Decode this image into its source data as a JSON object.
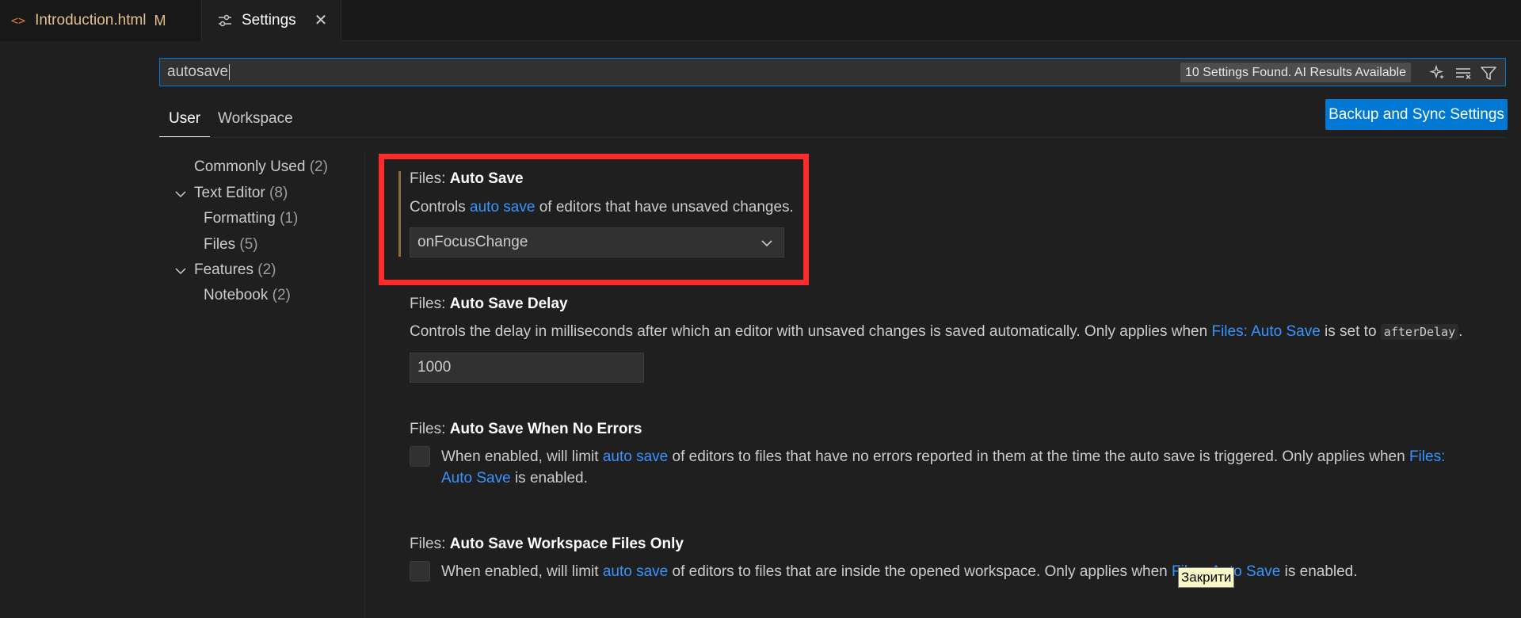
{
  "tabs": {
    "file_tab": {
      "label": "Introduction.html",
      "status": "M",
      "icon": "html-icon"
    },
    "settings_tab": {
      "label": "Settings",
      "icon": "settings-icon",
      "close": "✕"
    }
  },
  "search": {
    "value": "autosave",
    "results_badge": "10 Settings Found. AI Results Available",
    "buttons": [
      "sparkle-icon",
      "clear-filter-icon",
      "filter-icon"
    ]
  },
  "scopes": {
    "user": "User",
    "workspace": "Workspace"
  },
  "sync_button": "Backup and Sync Settings",
  "toc": [
    {
      "label": "Commonly Used",
      "count": "(2)",
      "expandable": false
    },
    {
      "label": "Text Editor",
      "count": "(8)",
      "expandable": true
    },
    {
      "label": "Formatting",
      "count": "(1)",
      "expandable": false
    },
    {
      "label": "Files",
      "count": "(5)",
      "expandable": false
    },
    {
      "label": "Features",
      "count": "(2)",
      "expandable": true
    },
    {
      "label": "Notebook",
      "count": "(2)",
      "expandable": false
    }
  ],
  "settings": {
    "auto_save": {
      "category": "Files: ",
      "name": "Auto Save",
      "desc_pre": "Controls ",
      "desc_link": "auto save",
      "desc_post": " of editors that have unsaved changes.",
      "value": "onFocusChange"
    },
    "auto_save_delay": {
      "category": "Files: ",
      "name": "Auto Save Delay",
      "desc_pre": "Controls the delay in milliseconds after which an editor with unsaved changes is saved automatically. Only applies when ",
      "desc_link": "Files: Auto Save",
      "desc_mid": " is set to ",
      "desc_code": "afterDelay",
      "desc_post": ".",
      "value": "1000"
    },
    "auto_save_no_errors": {
      "category": "Files: ",
      "name": "Auto Save When No Errors",
      "desc_pre": "When enabled, will limit ",
      "desc_link": "auto save",
      "desc_mid": " of editors to files that have no errors reported in them at the time the auto save is triggered. Only applies when ",
      "desc_link2": "Files: Auto Save",
      "desc_post": " is enabled.",
      "checked": false
    },
    "auto_save_workspace": {
      "category": "Files: ",
      "name": "Auto Save Workspace Files Only",
      "desc_pre": "When enabled, will limit ",
      "desc_link": "auto save",
      "desc_mid": " of editors to files that are inside the opened workspace. Only applies when ",
      "desc_link2": "Files: Auto Save",
      "desc_post": " is enabled.",
      "checked": false
    }
  },
  "tooltip": "Закрити",
  "colors": {
    "accent": "#0078d4",
    "link": "#3794ff",
    "highlight_border": "#ff2a2a",
    "modified_tab": "#e2c08d"
  }
}
